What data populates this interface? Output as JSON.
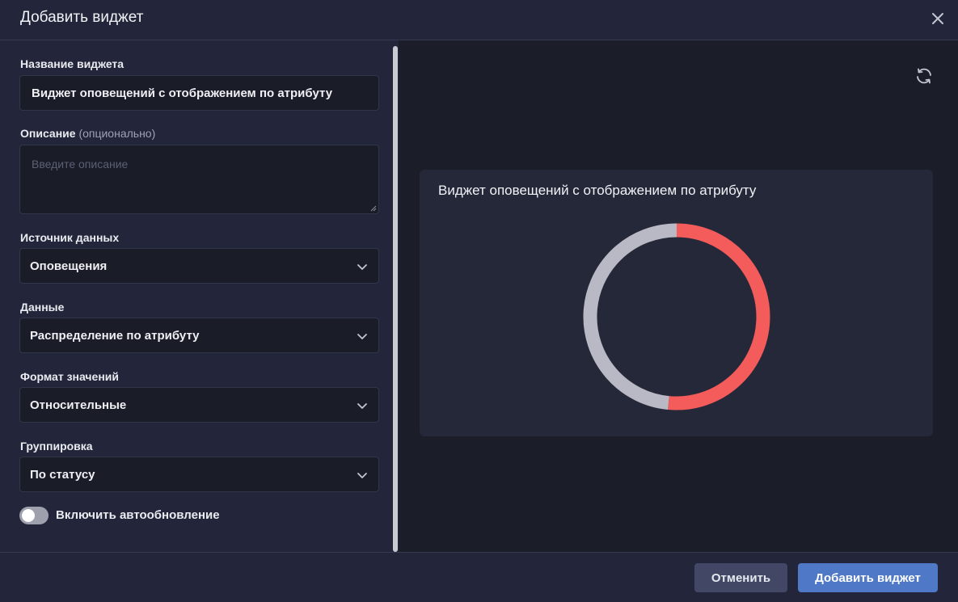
{
  "dialog": {
    "title": "Добавить виджет",
    "close_icon": "close-icon"
  },
  "form": {
    "name": {
      "label": "Название виджета",
      "value": "Виджет оповещений с отображением по атрибуту"
    },
    "description": {
      "label": "Описание",
      "optional": "(опционально)",
      "placeholder": "Введите описание"
    },
    "source": {
      "label": "Источник данных",
      "value": "Оповещения"
    },
    "data": {
      "label": "Данные",
      "value": "Распределение по атрибуту"
    },
    "format": {
      "label": "Формат значений",
      "value": "Относительные"
    },
    "grouping": {
      "label": "Группировка",
      "value": "По статусу"
    },
    "autorefresh": {
      "label": "Включить автообновление",
      "enabled": false
    }
  },
  "preview": {
    "title": "Виджет оповещений с отображением по атрибуту",
    "refresh_icon": "refresh-icon"
  },
  "colors": {
    "accent": "#4f79c6",
    "series_a": "#f45b5b",
    "series_b": "#b8b9c4"
  },
  "chart_data": {
    "type": "pie",
    "donut": true,
    "series": [
      {
        "value": 51.5,
        "color": "#f45b5b"
      },
      {
        "value": 48.5,
        "color": "#b8b9c4"
      }
    ]
  },
  "footer": {
    "cancel_label": "Отменить",
    "add_label": "Добавить виджет"
  }
}
